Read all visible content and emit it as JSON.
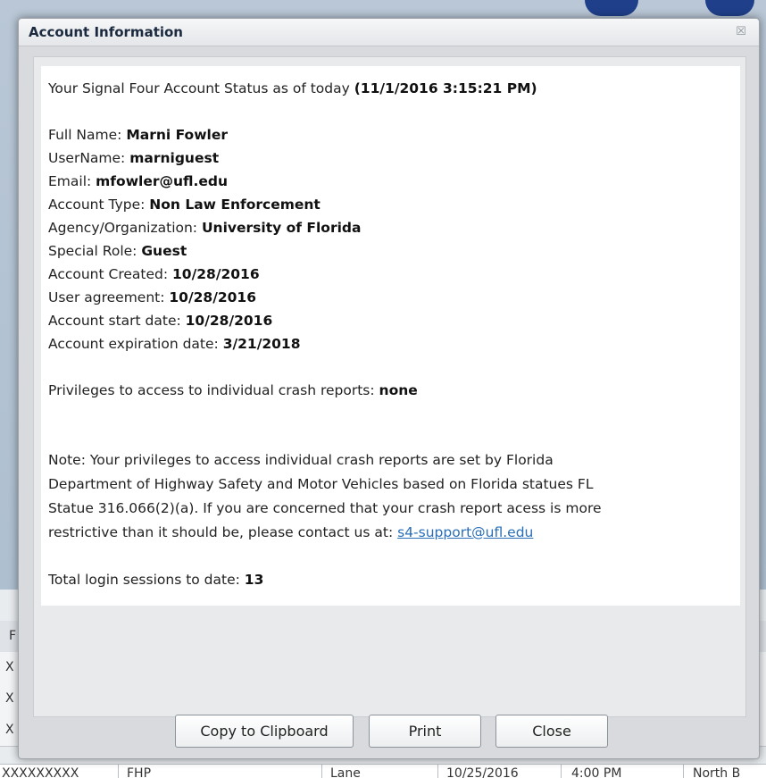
{
  "dialog": {
    "title": "Account Information",
    "close_glyph": "☒"
  },
  "account": {
    "status_prefix": "Your Signal Four Account Status as of today ",
    "status_timestamp": "(11/1/2016 3:15:21 PM)",
    "fields": [
      {
        "label": "Full Name: ",
        "value": "Marni Fowler"
      },
      {
        "label": "UserName: ",
        "value": "marniguest"
      },
      {
        "label": "Email: ",
        "value": "mfowler@ufl.edu"
      },
      {
        "label": "Account Type: ",
        "value": "Non Law Enforcement"
      },
      {
        "label": "Agency/Organization: ",
        "value": "University of Florida"
      },
      {
        "label": "Special Role: ",
        "value": "Guest"
      },
      {
        "label": "Account Created: ",
        "value": "10/28/2016"
      },
      {
        "label": "User agreement: ",
        "value": "10/28/2016"
      },
      {
        "label": "Account start date: ",
        "value": "10/28/2016"
      },
      {
        "label": "Account expiration date: ",
        "value": "3/21/2018"
      }
    ],
    "privileges_label": "Privileges to access to individual crash reports: ",
    "privileges_value": "none",
    "note_line1": "Note: Your privileges to access individual crash reports are set by Florida",
    "note_line2": "Department of Highway Safety and Motor Vehicles based on Florida statues FL",
    "note_line3": "Statue 316.066(2)(a).  If you are concerned that your crash report acess is more",
    "note_line4_prefix": "restrictive than it should be, please contact us at: ",
    "support_email": "s4-support@ufl.edu",
    "sessions_label": "Total login sessions to date: ",
    "sessions_value": "13"
  },
  "buttons": {
    "copy_label": "Copy to Clipboard",
    "print_label": "Print",
    "close_label": "Close"
  },
  "background": {
    "header_cell": "F",
    "row_cells": [
      "X",
      "X",
      "X"
    ],
    "bottom_row": [
      "XXXXXXXXX",
      "FHP",
      "Lane",
      "10/25/2016",
      "4:00 PM",
      "North B"
    ]
  },
  "colors": {
    "link": "#2a6fb8",
    "title_text": "#1b2a3f",
    "dialog_bg": "#d8dadd"
  }
}
